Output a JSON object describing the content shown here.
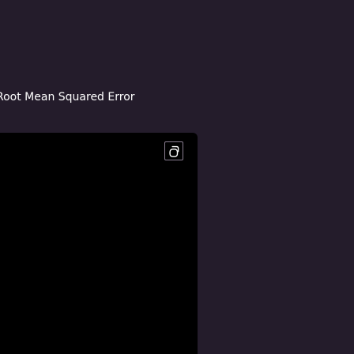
{
  "section": {
    "title": "Root Mean Squared Error"
  },
  "code_panel": {
    "copy_icon": "copy-icon",
    "code_text": ""
  },
  "colors": {
    "page_background": "#241c2b",
    "panel_background": "#000000",
    "text": "#ffffff",
    "icon_stroke": "#ffffff",
    "button_border": "#8b7f92"
  }
}
